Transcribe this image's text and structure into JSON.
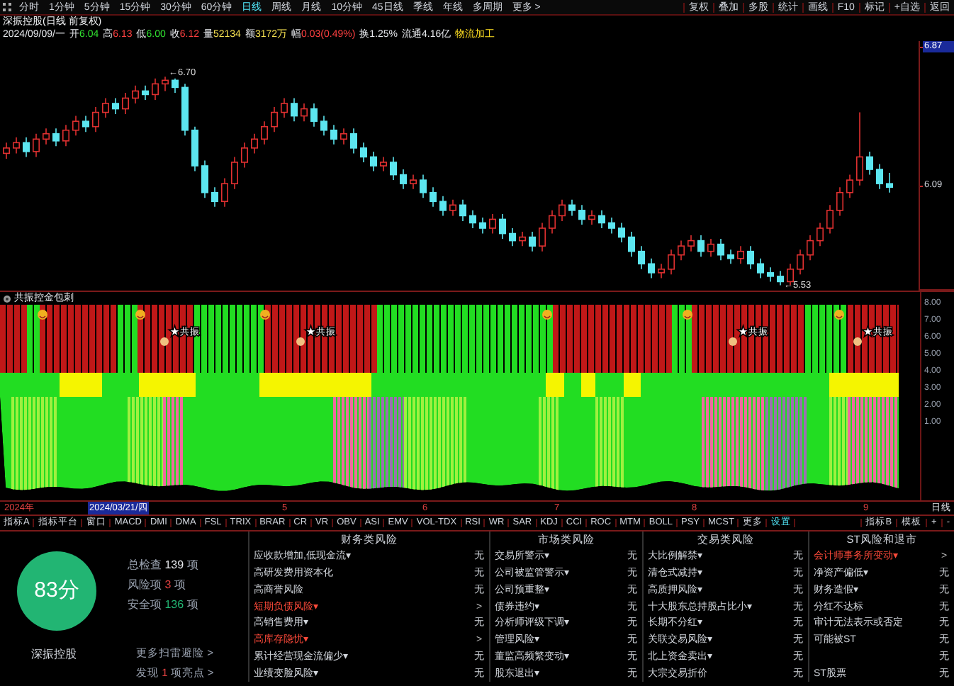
{
  "periods": [
    {
      "label": "分时",
      "selected": false
    },
    {
      "label": "1分钟",
      "selected": false
    },
    {
      "label": "5分钟",
      "selected": false
    },
    {
      "label": "15分钟",
      "selected": false
    },
    {
      "label": "30分钟",
      "selected": false
    },
    {
      "label": "60分钟",
      "selected": false
    },
    {
      "label": "日线",
      "selected": true
    },
    {
      "label": "周线",
      "selected": false
    },
    {
      "label": "月线",
      "selected": false
    },
    {
      "label": "10分钟",
      "selected": false
    },
    {
      "label": "45日线",
      "selected": false
    },
    {
      "label": "季线",
      "selected": false
    },
    {
      "label": "年线",
      "selected": false
    },
    {
      "label": "多周期",
      "selected": false
    },
    {
      "label": "更多 >",
      "selected": false
    }
  ],
  "tools": [
    "复权",
    "叠加",
    "多股",
    "统计",
    "画线",
    "F10",
    "标记",
    "+自选",
    "返回"
  ],
  "info": {
    "title": "深振控股(日线 前复权)",
    "date": "2024/09/09/一",
    "fields": [
      {
        "label": "开",
        "value": "6.04",
        "color": "#30e030"
      },
      {
        "label": "高",
        "value": "6.13",
        "color": "#ff4040"
      },
      {
        "label": "低",
        "value": "6.00",
        "color": "#30e030"
      },
      {
        "label": "收",
        "value": "6.12",
        "color": "#ff4040"
      },
      {
        "label": "量",
        "value": "52134",
        "color": "#f5e050"
      },
      {
        "label": "额",
        "value": "3172万",
        "color": "#f5e050"
      },
      {
        "label": "幅",
        "value": "0.03(0.49%)",
        "color": "#ff4040"
      },
      {
        "label": "换",
        "value": "1.25%",
        "color": "#e5e7eb"
      },
      {
        "label": "流通",
        "value": "4.16亿",
        "color": "#e5e7eb"
      }
    ],
    "industry": "物流加工"
  },
  "price_chart": {
    "high_note": "←6.70",
    "low_note": "←5.53",
    "chart_data": {
      "type": "candlestick",
      "ylim": [
        5.5,
        6.9
      ],
      "yticks": [
        6.87,
        6.09
      ],
      "ohlc": [
        [
          6.27,
          6.33,
          6.24,
          6.3
        ],
        [
          6.3,
          6.36,
          6.27,
          6.33
        ],
        [
          6.33,
          6.36,
          6.25,
          6.28
        ],
        [
          6.28,
          6.38,
          6.25,
          6.35
        ],
        [
          6.35,
          6.41,
          6.32,
          6.38
        ],
        [
          6.38,
          6.41,
          6.31,
          6.34
        ],
        [
          6.34,
          6.43,
          6.31,
          6.4
        ],
        [
          6.4,
          6.48,
          6.37,
          6.45
        ],
        [
          6.45,
          6.48,
          6.39,
          6.42
        ],
        [
          6.42,
          6.53,
          6.39,
          6.5
        ],
        [
          6.5,
          6.58,
          6.47,
          6.55
        ],
        [
          6.55,
          6.58,
          6.49,
          6.52
        ],
        [
          6.52,
          6.61,
          6.49,
          6.58
        ],
        [
          6.58,
          6.65,
          6.55,
          6.62
        ],
        [
          6.62,
          6.65,
          6.57,
          6.6
        ],
        [
          6.6,
          6.69,
          6.57,
          6.66
        ],
        [
          6.66,
          6.7,
          6.62,
          6.68
        ],
        [
          6.68,
          6.69,
          6.61,
          6.64
        ],
        [
          6.64,
          6.66,
          6.37,
          6.4
        ],
        [
          6.4,
          6.42,
          6.17,
          6.2
        ],
        [
          6.2,
          6.23,
          6.02,
          6.05
        ],
        [
          6.05,
          6.08,
          5.97,
          6.0
        ],
        [
          6.0,
          6.13,
          5.97,
          6.1
        ],
        [
          6.1,
          6.25,
          6.07,
          6.22
        ],
        [
          6.22,
          6.33,
          6.19,
          6.3
        ],
        [
          6.3,
          6.38,
          6.27,
          6.35
        ],
        [
          6.35,
          6.45,
          6.32,
          6.42
        ],
        [
          6.42,
          6.53,
          6.39,
          6.5
        ],
        [
          6.5,
          6.58,
          6.47,
          6.55
        ],
        [
          6.55,
          6.58,
          6.45,
          6.48
        ],
        [
          6.48,
          6.55,
          6.45,
          6.52
        ],
        [
          6.52,
          6.55,
          6.42,
          6.45
        ],
        [
          6.45,
          6.48,
          6.37,
          6.4
        ],
        [
          6.4,
          6.43,
          6.32,
          6.35
        ],
        [
          6.35,
          6.41,
          6.32,
          6.38
        ],
        [
          6.38,
          6.41,
          6.27,
          6.3
        ],
        [
          6.3,
          6.33,
          6.22,
          6.25
        ],
        [
          6.25,
          6.28,
          6.17,
          6.2
        ],
        [
          6.2,
          6.25,
          6.17,
          6.22
        ],
        [
          6.22,
          6.25,
          6.12,
          6.15
        ],
        [
          6.15,
          6.18,
          6.07,
          6.1
        ],
        [
          6.1,
          6.15,
          6.07,
          6.12
        ],
        [
          6.12,
          6.15,
          6.02,
          6.05
        ],
        [
          6.05,
          6.08,
          5.97,
          6.0
        ],
        [
          6.0,
          6.03,
          5.92,
          5.95
        ],
        [
          5.95,
          6.01,
          5.92,
          5.98
        ],
        [
          5.98,
          6.01,
          5.89,
          5.92
        ],
        [
          5.92,
          5.95,
          5.85,
          5.88
        ],
        [
          5.88,
          5.91,
          5.82,
          5.85
        ],
        [
          5.85,
          5.93,
          5.82,
          5.9
        ],
        [
          5.9,
          5.93,
          5.79,
          5.82
        ],
        [
          5.82,
          5.85,
          5.75,
          5.78
        ],
        [
          5.78,
          5.83,
          5.75,
          5.8
        ],
        [
          5.8,
          5.83,
          5.72,
          5.75
        ],
        [
          5.75,
          5.88,
          5.72,
          5.85
        ],
        [
          5.85,
          5.95,
          5.82,
          5.92
        ],
        [
          5.92,
          6.01,
          5.89,
          5.98
        ],
        [
          5.98,
          6.01,
          5.92,
          5.95
        ],
        [
          5.95,
          5.98,
          5.87,
          5.9
        ],
        [
          5.9,
          5.95,
          5.87,
          5.92
        ],
        [
          5.92,
          5.95,
          5.85,
          5.88
        ],
        [
          5.88,
          5.91,
          5.82,
          5.85
        ],
        [
          5.85,
          5.88,
          5.77,
          5.8
        ],
        [
          5.8,
          5.83,
          5.69,
          5.72
        ],
        [
          5.72,
          5.75,
          5.62,
          5.65
        ],
        [
          5.65,
          5.68,
          5.57,
          5.6
        ],
        [
          5.6,
          5.65,
          5.57,
          5.62
        ],
        [
          5.62,
          5.73,
          5.59,
          5.7
        ],
        [
          5.7,
          5.78,
          5.67,
          5.75
        ],
        [
          5.75,
          5.81,
          5.72,
          5.78
        ],
        [
          5.78,
          5.81,
          5.69,
          5.72
        ],
        [
          5.72,
          5.79,
          5.69,
          5.76
        ],
        [
          5.76,
          5.79,
          5.67,
          5.7
        ],
        [
          5.7,
          5.73,
          5.65,
          5.68
        ],
        [
          5.68,
          5.75,
          5.65,
          5.72
        ],
        [
          5.72,
          5.75,
          5.62,
          5.65
        ],
        [
          5.65,
          5.68,
          5.57,
          5.6
        ],
        [
          5.6,
          5.63,
          5.55,
          5.58
        ],
        [
          5.58,
          5.61,
          5.53,
          5.55
        ],
        [
          5.55,
          5.65,
          5.53,
          5.62
        ],
        [
          5.62,
          5.73,
          5.59,
          5.7
        ],
        [
          5.7,
          5.81,
          5.67,
          5.78
        ],
        [
          5.78,
          5.88,
          5.75,
          5.85
        ],
        [
          5.85,
          5.98,
          5.82,
          5.95
        ],
        [
          5.95,
          6.08,
          5.92,
          6.05
        ],
        [
          6.05,
          6.15,
          6.02,
          6.12
        ],
        [
          6.12,
          6.5,
          6.09,
          6.25
        ],
        [
          6.25,
          6.28,
          6.15,
          6.18
        ],
        [
          6.18,
          6.21,
          6.07,
          6.1
        ],
        [
          6.1,
          6.16,
          6.05,
          6.08
        ]
      ]
    }
  },
  "indicator": {
    "title": "共振控金包刺",
    "axis_labels": [
      "8.00",
      "7.00",
      "6.00",
      "5.00",
      "4.00",
      "3.00",
      "2.00",
      "1.00"
    ],
    "markers": [
      "★共振",
      "★共振",
      "★共振",
      "★共振"
    ]
  },
  "date_axis": {
    "labels": [
      {
        "text": "2024年",
        "selected": false
      },
      {
        "text": "2024/03/21/四",
        "selected": true
      },
      {
        "text": "5",
        "selected": false
      },
      {
        "text": "6",
        "selected": false
      },
      {
        "text": "7",
        "selected": false
      },
      {
        "text": "8",
        "selected": false
      },
      {
        "text": "9",
        "selected": false
      }
    ],
    "period": "日线"
  },
  "indicator_tabs": [
    {
      "label": "指标A",
      "selected": false
    },
    {
      "label": "指标平台",
      "selected": false
    },
    {
      "label": "窗口",
      "selected": false
    },
    {
      "label": "MACD",
      "selected": false
    },
    {
      "label": "DMI",
      "selected": false
    },
    {
      "label": "DMA",
      "selected": false
    },
    {
      "label": "FSL",
      "selected": false
    },
    {
      "label": "TRIX",
      "selected": false
    },
    {
      "label": "BRAR",
      "selected": false
    },
    {
      "label": "CR",
      "selected": false
    },
    {
      "label": "VR",
      "selected": false
    },
    {
      "label": "OBV",
      "selected": false
    },
    {
      "label": "ASI",
      "selected": false
    },
    {
      "label": "EMV",
      "selected": false
    },
    {
      "label": "VOL-TDX",
      "selected": false
    },
    {
      "label": "RSI",
      "selected": false
    },
    {
      "label": "WR",
      "selected": false
    },
    {
      "label": "SAR",
      "selected": false
    },
    {
      "label": "KDJ",
      "selected": false
    },
    {
      "label": "CCI",
      "selected": false
    },
    {
      "label": "ROC",
      "selected": false
    },
    {
      "label": "MTM",
      "selected": false
    },
    {
      "label": "BOLL",
      "selected": false
    },
    {
      "label": "PSY",
      "selected": false
    },
    {
      "label": "MCST",
      "selected": false
    },
    {
      "label": "更多",
      "selected": false
    },
    {
      "label": "设置",
      "selected": true
    }
  ],
  "indicator_tools": [
    "指标B",
    "模板",
    "+",
    "-"
  ],
  "risk_summary": {
    "score": "83分",
    "stock": "深振控股",
    "stats": [
      {
        "label": "总检查",
        "count": "139",
        "unit": "项",
        "color": "#e5e7eb"
      },
      {
        "label": "风险项",
        "count": "3",
        "unit": "项",
        "color": "#e04040"
      },
      {
        "label": "安全项",
        "count": "136",
        "unit": "项",
        "color": "#22b573"
      }
    ],
    "links": [
      {
        "text": "更多扫雷避险 >"
      },
      {
        "text": "发现 ",
        "count": "1",
        "rest": " 项亮点 >"
      }
    ]
  },
  "risk_columns": [
    {
      "title": "财务类风险",
      "items": [
        {
          "label": "应收款增加,低现金流▾",
          "status": "无",
          "risk": false
        },
        {
          "label": "高研发费用资本化",
          "status": "无",
          "risk": false
        },
        {
          "label": "高商誉风险",
          "status": "无",
          "risk": false
        },
        {
          "label": "短期负债风险▾",
          "status": ">",
          "risk": true
        },
        {
          "label": "高销售费用▾",
          "status": "无",
          "risk": false
        },
        {
          "label": "高库存隐忧▾",
          "status": ">",
          "risk": true
        },
        {
          "label": "累计经营现金流偏少▾",
          "status": "无",
          "risk": false
        },
        {
          "label": "业绩变脸风险▾",
          "status": "无",
          "risk": false
        }
      ]
    },
    {
      "title": "市场类风险",
      "items": [
        {
          "label": "交易所警示▾",
          "status": "无",
          "risk": false
        },
        {
          "label": "公司被监管警示▾",
          "status": "无",
          "risk": false
        },
        {
          "label": "公司预重整▾",
          "status": "无",
          "risk": false
        },
        {
          "label": "债券违约▾",
          "status": "无",
          "risk": false
        },
        {
          "label": "分析师评级下调▾",
          "status": "无",
          "risk": false
        },
        {
          "label": "管理风险▾",
          "status": "无",
          "risk": false
        },
        {
          "label": "董监高频繁变动▾",
          "status": "无",
          "risk": false
        },
        {
          "label": "股东退出▾",
          "status": "无",
          "risk": false
        }
      ]
    },
    {
      "title": "交易类风险",
      "items": [
        {
          "label": "大比例解禁▾",
          "status": "无",
          "risk": false
        },
        {
          "label": "清仓式减持▾",
          "status": "无",
          "risk": false
        },
        {
          "label": "高质押风险▾",
          "status": "无",
          "risk": false
        },
        {
          "label": "十大股东总持股占比小▾",
          "status": "无",
          "risk": false
        },
        {
          "label": "长期不分红▾",
          "status": "无",
          "risk": false
        },
        {
          "label": "关联交易风险▾",
          "status": "无",
          "risk": false
        },
        {
          "label": "北上资金卖出▾",
          "status": "无",
          "risk": false
        },
        {
          "label": "大宗交易折价",
          "status": "无",
          "risk": false
        }
      ]
    },
    {
      "title": "ST风险和退市",
      "items": [
        {
          "label": "会计师事务所变动▾",
          "status": ">",
          "risk": true
        },
        {
          "label": "净资产偏低▾",
          "status": "无",
          "risk": false
        },
        {
          "label": "财务造假▾",
          "status": "无",
          "risk": false
        },
        {
          "label": "分红不达标",
          "status": "无",
          "risk": false
        },
        {
          "label": "审计无法表示或否定",
          "status": "无",
          "risk": false
        },
        {
          "label": "可能被ST",
          "status": "无",
          "risk": false
        },
        {
          "status": "无"
        },
        {
          "label": "ST股票",
          "status": "无",
          "risk": false
        }
      ]
    }
  ]
}
